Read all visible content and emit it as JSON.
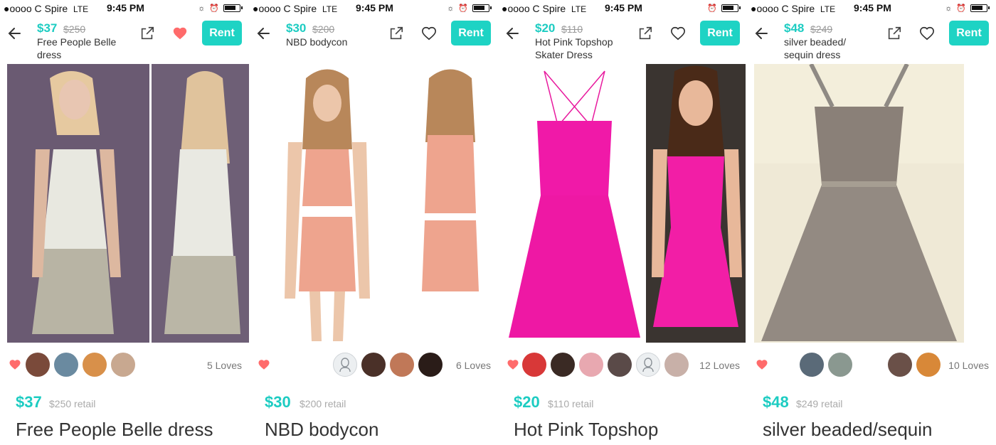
{
  "status_bar": {
    "carrier": "C Spire",
    "signal": "●oooo",
    "network": "LTE",
    "time": "9:45 PM"
  },
  "rent_label": "Rent",
  "colors": {
    "accent": "#1dccc2",
    "rent_button": "#1ed3c4",
    "heart_filled": "#ff6b6b"
  },
  "listings": [
    {
      "price": "$37",
      "retail_strike": "$250",
      "header_title": "Free People Belle dress",
      "header_favorited": true,
      "loves": "5 Loves",
      "retail_label": "$250 retail",
      "title": "Free People Belle dress"
    },
    {
      "price": "$30",
      "retail_strike": "$200",
      "header_title": "NBD bodycon",
      "header_favorited": false,
      "loves": "6 Loves",
      "retail_label": "$200 retail",
      "title": "NBD bodycon"
    },
    {
      "price": "$20",
      "retail_strike": "$110",
      "header_title": "Hot Pink Topshop Skater Dress",
      "header_favorited": false,
      "loves": "12 Loves",
      "retail_label": "$110 retail",
      "title": "Hot Pink Topshop"
    },
    {
      "price": "$48",
      "retail_strike": "$249",
      "header_title": "silver beaded/ sequin dress",
      "header_favorited": false,
      "loves": "10 Loves",
      "retail_label": "$249 retail",
      "title": "silver beaded/sequin"
    }
  ],
  "icons": {
    "back": "arrow-left-icon",
    "share": "external-link-icon",
    "favorite": "heart-icon",
    "love": "heart-icon"
  }
}
